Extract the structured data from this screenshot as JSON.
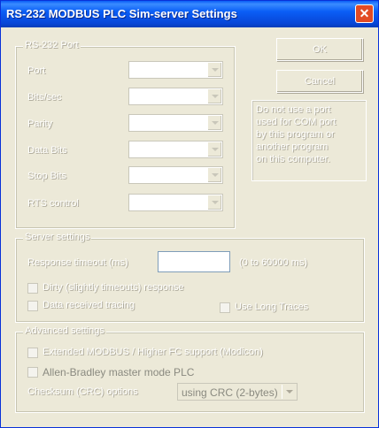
{
  "window": {
    "title": "RS-232 MODBUS PLC Sim-server Settings",
    "close_glyph": "✕"
  },
  "buttons": {
    "ok": "OK",
    "cancel": "Cancel"
  },
  "rs232": {
    "legend": "RS-232 Port",
    "fields": [
      {
        "label": "Port"
      },
      {
        "label": "Bits/sec"
      },
      {
        "label": "Parity"
      },
      {
        "label": "Data Bits"
      },
      {
        "label": "Stop Bits"
      },
      {
        "label": "RTS control"
      }
    ]
  },
  "hint": {
    "lines": [
      "Do not use a port",
      "used for COM port",
      "by this program or",
      "another program",
      "on this computer."
    ]
  },
  "server": {
    "legend": "Server settings",
    "response_label": "Response timeout (ms)",
    "response_value": "",
    "range_hint": "(0 to 60000 ms)",
    "checkbox_1": "Dirty (slightly timeouts) response",
    "checkbox_2": "Data received tracing",
    "checkbox_3": "Use Long Traces"
  },
  "advanced": {
    "legend": "Advanced settings",
    "checkbox_1": "Extended MODBUS / Higher FC support (Modicon)",
    "checkbox_2": "Allen-Bradley master mode PLC",
    "crc_label": "Checksum (CRC) options",
    "crc_value": "using CRC (2-bytes)"
  }
}
